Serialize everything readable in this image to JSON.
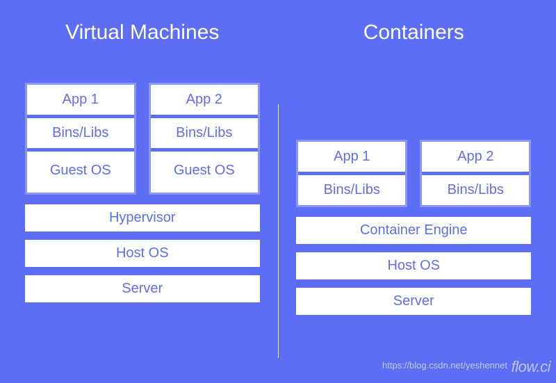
{
  "left": {
    "title": "Virtual Machines",
    "groups": [
      {
        "app": "App 1",
        "libs": "Bins/Libs",
        "os": "Guest OS"
      },
      {
        "app": "App 2",
        "libs": "Bins/Libs",
        "os": "Guest OS"
      }
    ],
    "layers": [
      "Hypervisor",
      "Host OS",
      "Server"
    ]
  },
  "right": {
    "title": "Containers",
    "groups": [
      {
        "app": "App 1",
        "libs": "Bins/Libs"
      },
      {
        "app": "App 2",
        "libs": "Bins/Libs"
      }
    ],
    "layers": [
      "Container Engine",
      "Host OS",
      "Server"
    ]
  },
  "watermark_url": "https://blog.csdn.net/yeshennet",
  "watermark_logo": "flow.ci"
}
